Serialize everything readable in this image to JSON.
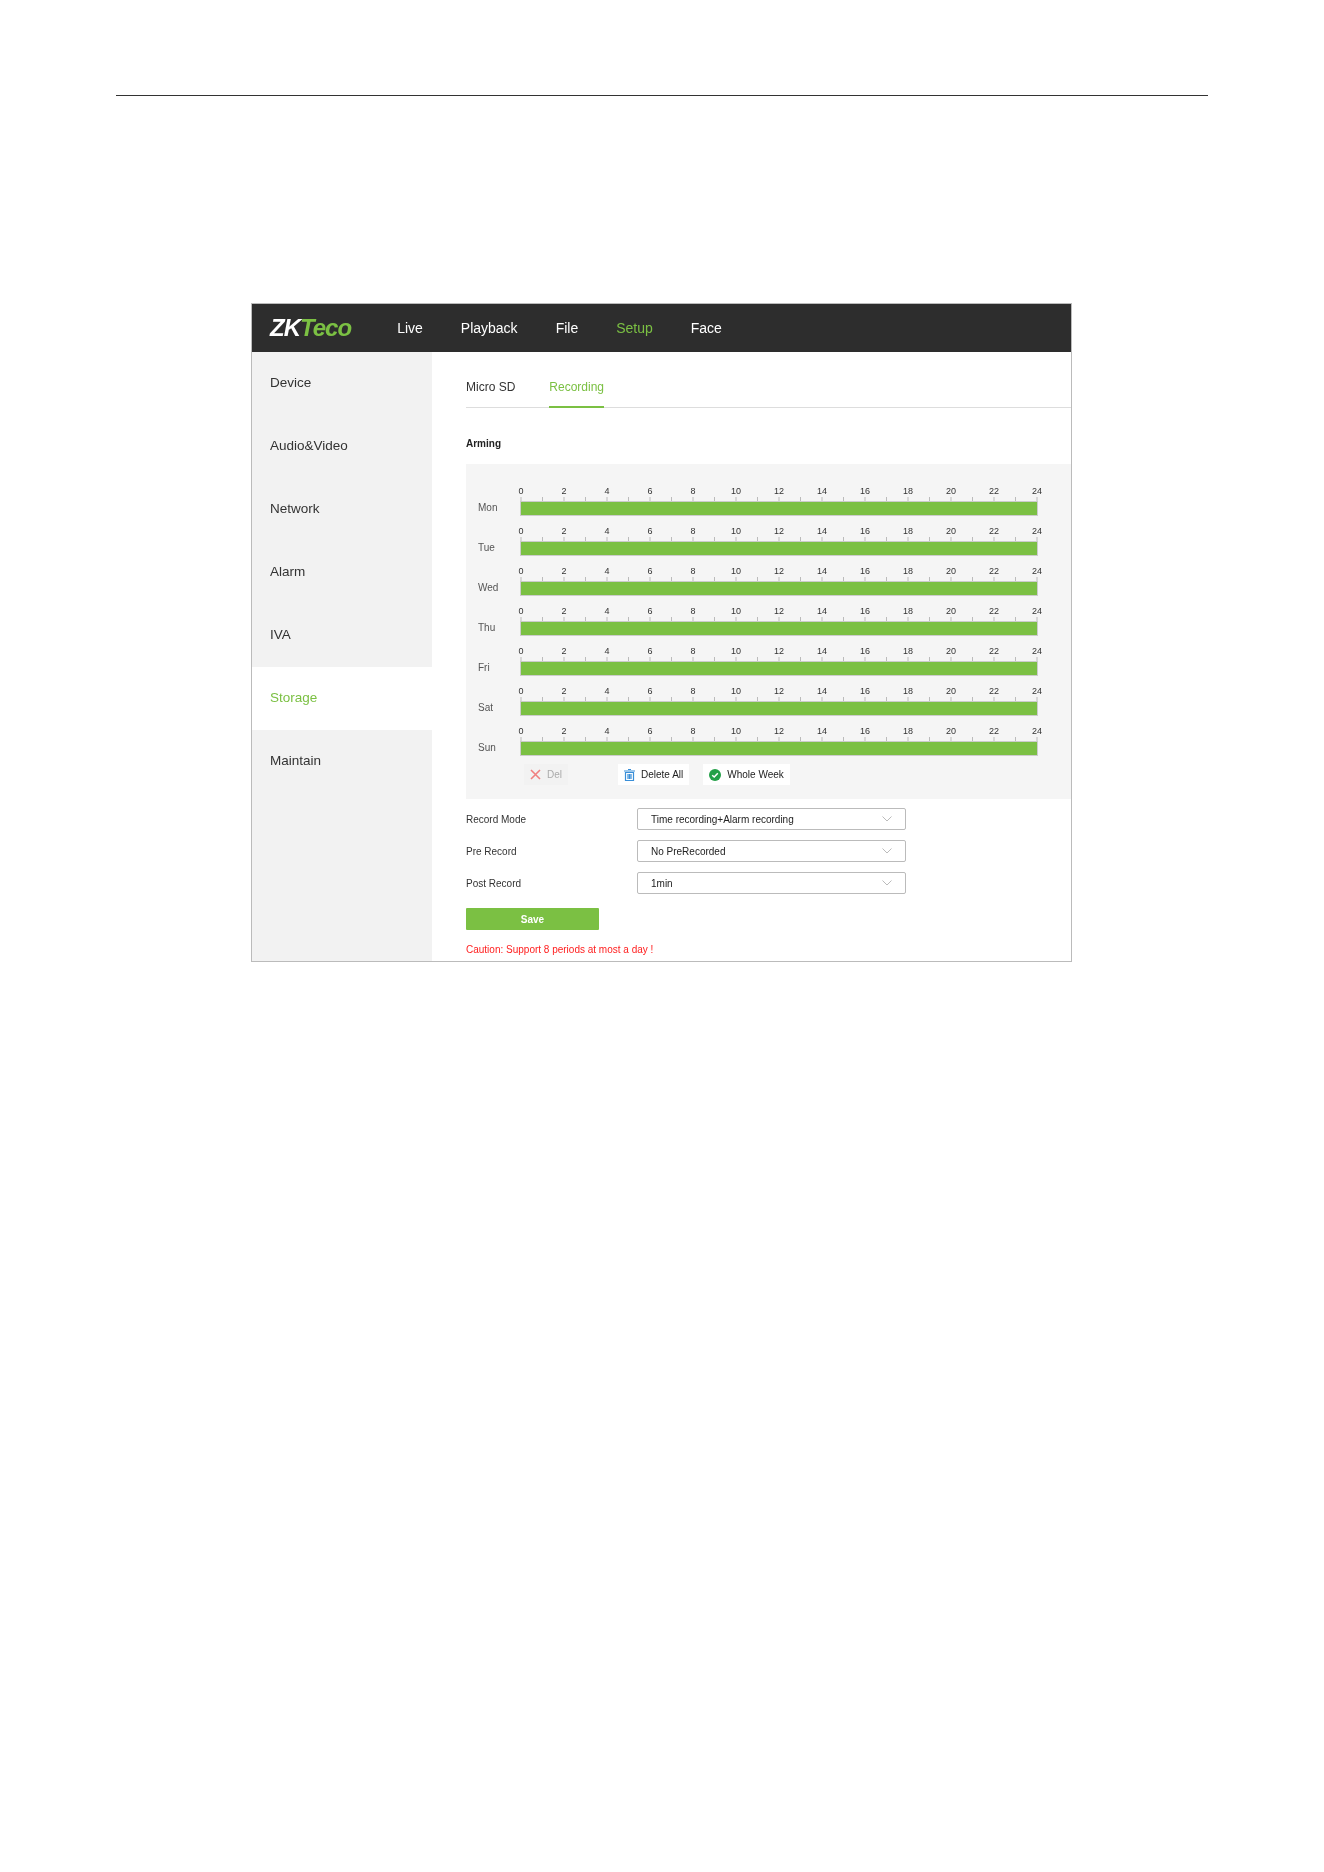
{
  "logo": {
    "part_1": "ZK",
    "part_2": "Teco"
  },
  "nav": [
    {
      "label": "Live",
      "selected": false
    },
    {
      "label": "Playback",
      "selected": false
    },
    {
      "label": "File",
      "selected": false
    },
    {
      "label": "Setup",
      "selected": true
    },
    {
      "label": "Face",
      "selected": false
    }
  ],
  "sidebar": {
    "items": [
      {
        "label": "Device",
        "selected": false
      },
      {
        "label": "Audio&Video",
        "selected": false
      },
      {
        "label": "Network",
        "selected": false
      },
      {
        "label": "Alarm",
        "selected": false
      },
      {
        "label": "IVA",
        "selected": false
      },
      {
        "label": "Storage",
        "selected": true
      },
      {
        "label": "Maintain",
        "selected": false
      }
    ]
  },
  "tabs": [
    {
      "label": "Micro SD",
      "selected": false
    },
    {
      "label": "Recording",
      "selected": true
    }
  ],
  "arming": {
    "title": "Arming",
    "days": [
      {
        "label": "Mon",
        "level": 1,
        "ticks": [
          "0",
          "2",
          "4",
          "6",
          "8",
          "10",
          "12",
          "14",
          "16",
          "18",
          "20",
          "22",
          "24"
        ]
      },
      {
        "label": "Tue",
        "level": 1,
        "ticks": [
          "0",
          "2",
          "4",
          "6",
          "8",
          "10",
          "12",
          "14",
          "16",
          "18",
          "20",
          "22",
          "24"
        ]
      },
      {
        "label": "Wed",
        "level": 1,
        "ticks": [
          "0",
          "2",
          "4",
          "6",
          "8",
          "10",
          "12",
          "14",
          "16",
          "18",
          "20",
          "22",
          "24"
        ]
      },
      {
        "label": "Thu",
        "level": 1,
        "ticks": [
          "0",
          "2",
          "4",
          "6",
          "8",
          "10",
          "12",
          "14",
          "16",
          "18",
          "20",
          "22",
          "24"
        ]
      },
      {
        "label": "Fri",
        "level": 1,
        "ticks": [
          "0",
          "2",
          "4",
          "6",
          "8",
          "10",
          "12",
          "14",
          "16",
          "18",
          "20",
          "22",
          "24"
        ]
      },
      {
        "label": "Sat",
        "level": 1,
        "ticks": [
          "0",
          "2",
          "4",
          "6",
          "8",
          "10",
          "12",
          "14",
          "16",
          "18",
          "20",
          "22",
          "24"
        ]
      },
      {
        "label": "Sun",
        "level": 1,
        "ticks": [
          "0",
          "2",
          "4",
          "6",
          "8",
          "10",
          "12",
          "14",
          "16",
          "18",
          "20",
          "22",
          "24"
        ]
      }
    ],
    "actions": [
      {
        "kind": "delete",
        "label": "Del",
        "disabled": true
      },
      {
        "kind": "delete_all",
        "label": "Delete All",
        "disabled": false
      },
      {
        "kind": "whole_week",
        "label": "Whole Week",
        "disabled": false
      }
    ]
  },
  "form": [
    {
      "label": "Record Mode",
      "value": "Time recording+Alarm recording"
    },
    {
      "label": "Pre Record",
      "value": "No PreRecorded"
    },
    {
      "label": "Post Record",
      "value": "1min"
    }
  ],
  "save_button": "Save",
  "caution": "Caution:  Support 8 periods at most a day !"
}
